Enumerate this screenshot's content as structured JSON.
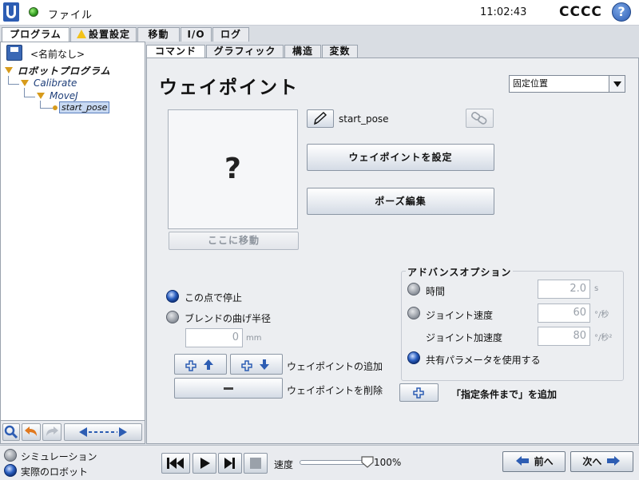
{
  "topbar": {
    "file_label": "ファイル",
    "clock": "11:02:43",
    "robot_name": "CCCC",
    "help_symbol": "?"
  },
  "main_tabs": [
    {
      "label": "プログラム",
      "active": true
    },
    {
      "label": "設置設定",
      "icon": "warning-icon"
    },
    {
      "label": "移動"
    },
    {
      "label": "I/O"
    },
    {
      "label": "ログ"
    }
  ],
  "sidebar": {
    "program_name": "<名前なし>",
    "tree": [
      {
        "label": "ロボットプログラム",
        "level": 0
      },
      {
        "label": "Calibrate",
        "level": 1
      },
      {
        "label": "MoveJ",
        "level": 2
      },
      {
        "label": "start_pose",
        "level": 3,
        "selected": true
      }
    ]
  },
  "sub_tabs": [
    {
      "label": "コマンド",
      "active": true
    },
    {
      "label": "グラフィック"
    },
    {
      "label": "構造"
    },
    {
      "label": "変数"
    }
  ],
  "waypoint": {
    "heading": "ウェイポイント",
    "position_mode": "固定位置",
    "preview_symbol": "?",
    "move_here_label": "ここに移動",
    "pose_name": "start_pose",
    "set_waypoint_label": "ウェイポイントを設定",
    "edit_pose_label": "ポーズ編集"
  },
  "stop_options": {
    "stop_at_point_label": "この点で停止",
    "blend_radius_label": "ブレンドの曲げ半径",
    "blend_value": "0",
    "blend_unit": "mm",
    "add_waypoint_label": "ウェイポイントの追加",
    "delete_waypoint_label": "ウェイポイントを削除",
    "add_until_label": "「指定条件まで」を追加"
  },
  "advanced": {
    "title": "アドバンスオプション",
    "time_label": "時間",
    "time_value": "2.0",
    "time_unit": "s",
    "joint_speed_label": "ジョイント速度",
    "joint_speed_value": "60",
    "joint_speed_unit": "°/秒",
    "joint_accel_label": "ジョイント加速度",
    "joint_accel_value": "80",
    "joint_accel_unit": "°/秒²",
    "shared_params_label": "共有パラメータを使用する"
  },
  "bottombar": {
    "simulation_label": "シミュレーション",
    "real_robot_label": "実際のロボット",
    "speed_label": "速度",
    "speed_value": "100%",
    "speed_fraction": 1.0,
    "prev_label": "前へ",
    "next_label": "次へ"
  },
  "colors": {
    "accent_blue": "#2b5fc0",
    "green_status": "#2f9a1e",
    "warning_yellow": "#f3c21a",
    "tree_orange": "#d79b1c"
  }
}
